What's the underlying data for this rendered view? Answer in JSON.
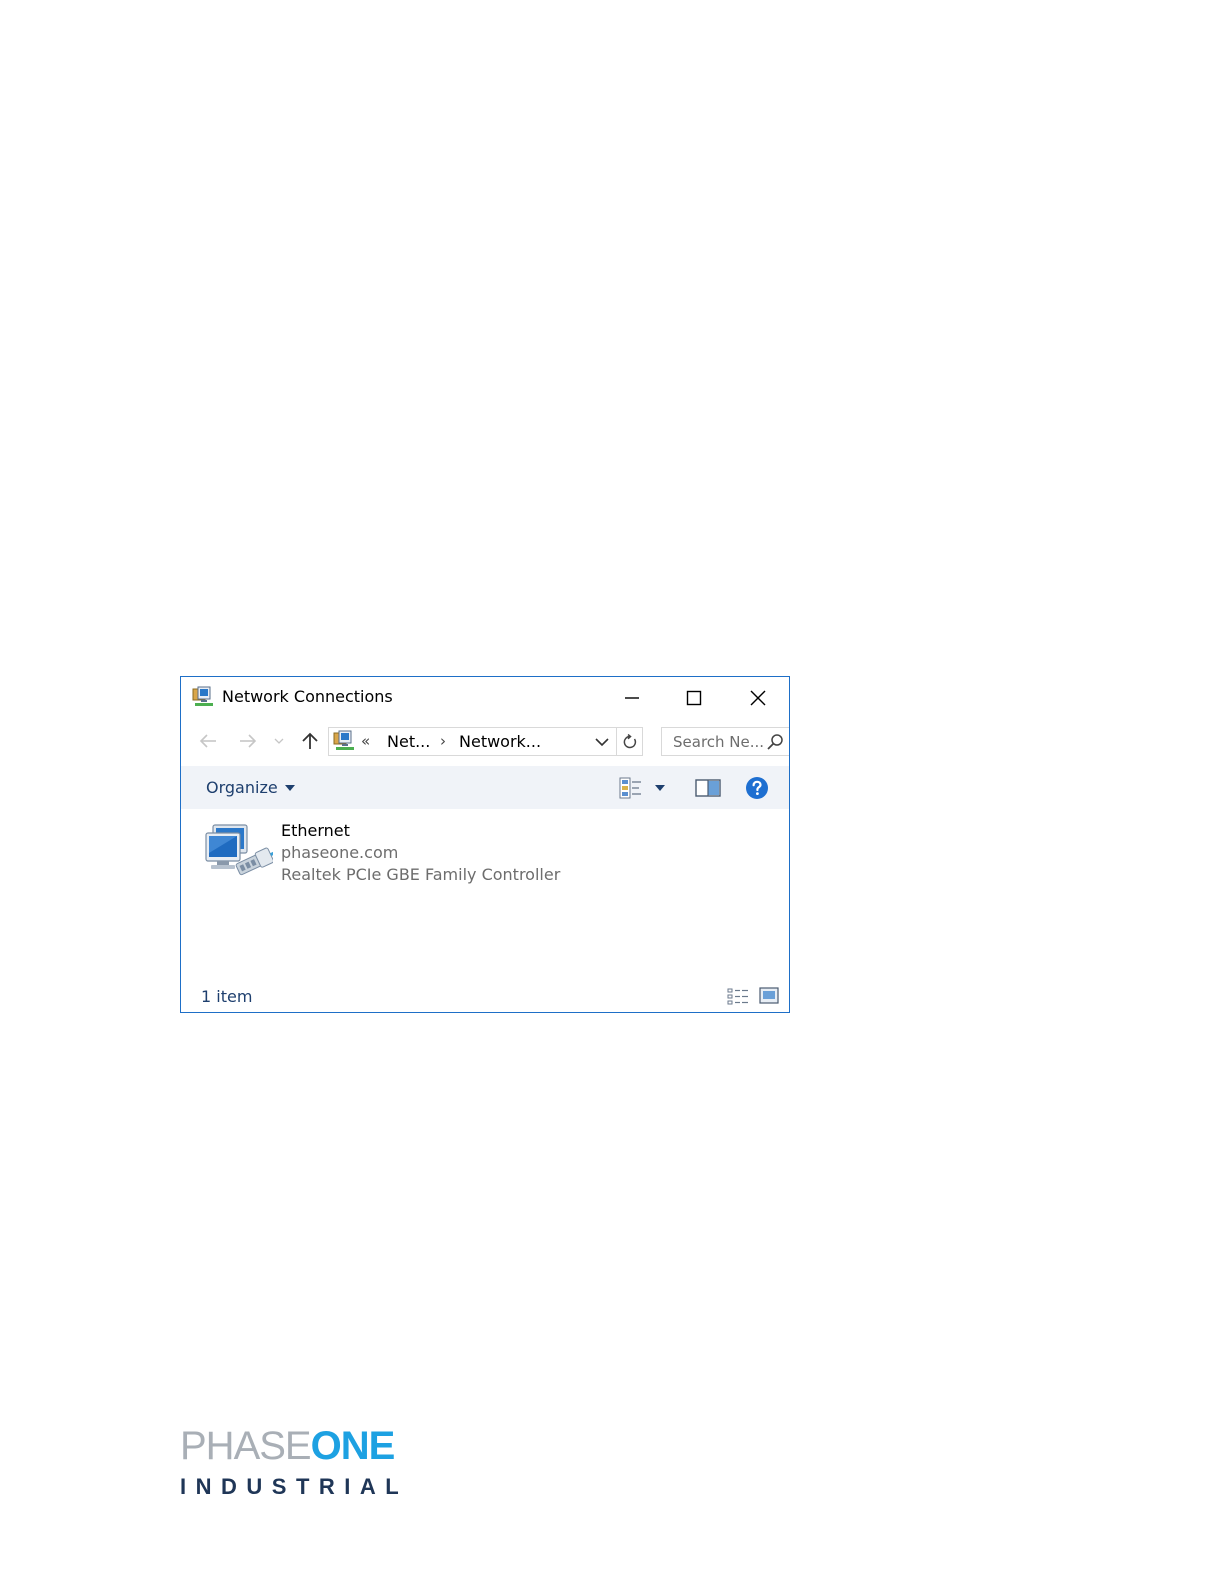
{
  "window": {
    "title": "Network Connections",
    "icon": "network-connections-icon"
  },
  "title_buttons": {
    "minimize": "minimize-icon",
    "maximize": "maximize-icon",
    "close": "close-icon"
  },
  "navigation": {
    "breadcrumb_overflow": "«",
    "breadcrumb": [
      "Net...",
      "Network..."
    ],
    "breadcrumb_separator": "›",
    "search_placeholder": "Search Ne..."
  },
  "commandbar": {
    "organize_label": "Organize"
  },
  "items": [
    {
      "name": "Ethernet",
      "network": "phaseone.com",
      "device": "Realtek PCIe GBE Family Controller",
      "icon": "ethernet-adapter-icon"
    }
  ],
  "status": {
    "item_count": "1 item"
  },
  "logo": {
    "phase": "PHASE",
    "one": "ONE",
    "industrial": "INDUSTRIAL"
  },
  "colors": {
    "window_border": "#1e6fc7",
    "command_bar_bg": "#f0f3f8",
    "link_text": "#1e3f6e",
    "logo_grey": "#a9afb6",
    "logo_blue": "#1da1e2",
    "logo_navy": "#1f3657"
  }
}
